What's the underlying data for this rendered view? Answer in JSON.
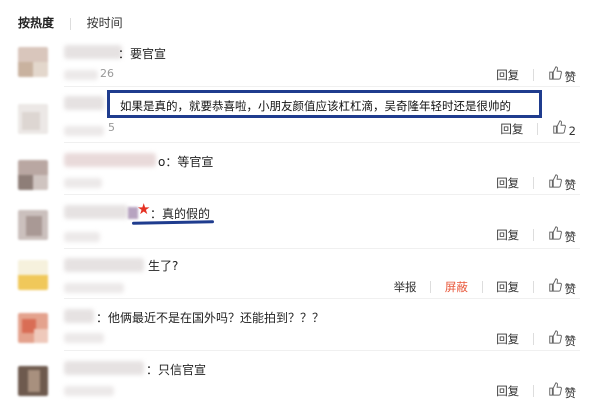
{
  "tabs": [
    {
      "label": "按热度",
      "active": true
    },
    {
      "label": "按时间",
      "active": false
    }
  ],
  "comments": [
    {
      "text": "：要官宣",
      "time_fragment": "26",
      "actions": {
        "reply": "回复",
        "like": "赞"
      }
    },
    {
      "text": "如果是真的，就要恭喜啦，小朋友颜值应该杠杠滴，吴奇隆年轻时还是很帅的",
      "time_fragment": "5",
      "actions": {
        "reply": "回复",
        "like_count": "2"
      }
    },
    {
      "text": "o：等官宣",
      "actions": {
        "reply": "回复",
        "like": "赞"
      }
    },
    {
      "text": "：真的假的",
      "actions": {
        "reply": "回复",
        "like": "赞"
      }
    },
    {
      "text": "生了?",
      "actions": {
        "report": "举报",
        "block": "屏蔽",
        "reply": "回复",
        "like": "赞"
      }
    },
    {
      "text": "：他俩最近不是在国外吗？还能拍到？？？",
      "actions": {
        "reply": "回复",
        "like": "赞"
      }
    },
    {
      "text": "：只信官宣",
      "actions": {
        "reply": "回复",
        "like": "赞"
      }
    }
  ],
  "colors": {
    "annotation_blue": "#1f3c8e",
    "block_red": "#e8573a",
    "star_red": "#e53224"
  },
  "icons": [
    "thumbs-up-icon",
    "star-icon"
  ]
}
